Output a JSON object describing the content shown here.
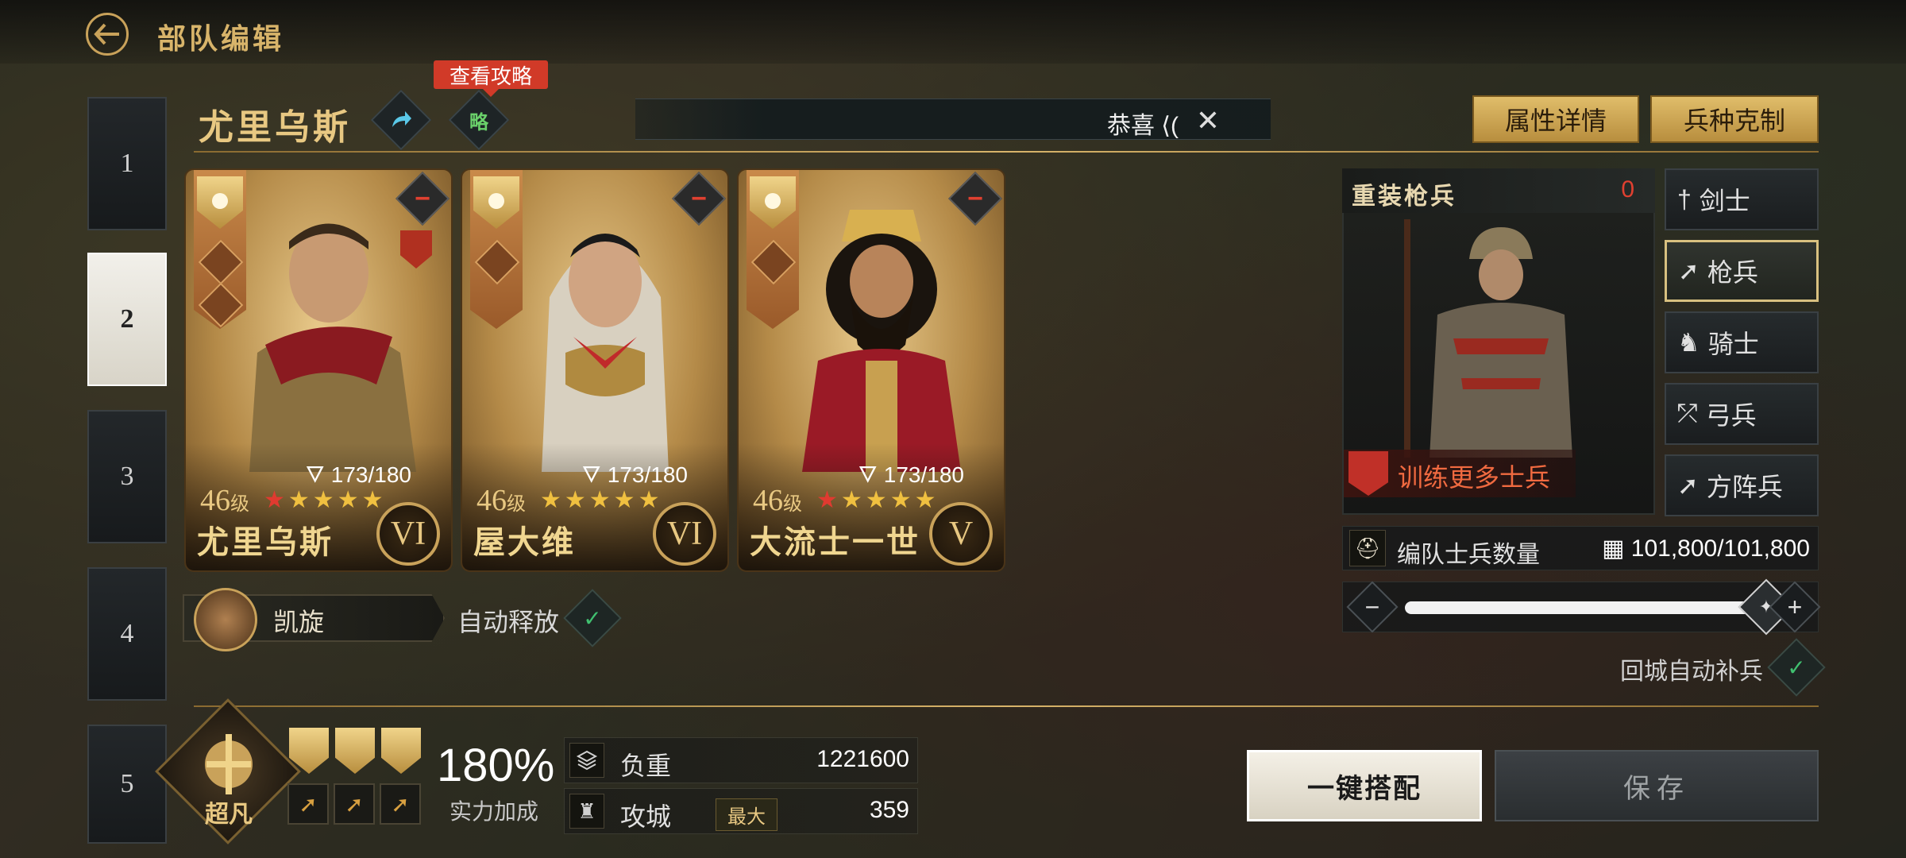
{
  "header": {
    "title": "部队编辑"
  },
  "tabs": [
    "1",
    "2",
    "3",
    "4",
    "5"
  ],
  "active_tab": "2",
  "lead_hero": {
    "name": "尤里乌斯",
    "guide_tag": "查看攻略",
    "guide_icon_text": "略"
  },
  "marquee": {
    "text": "恭喜 ⟨("
  },
  "top_buttons": {
    "attributes": "属性详情",
    "counter": "兵种克制"
  },
  "heroes": [
    {
      "name": "尤里乌斯",
      "level": "46",
      "level_unit": "级",
      "exp": "173/180",
      "rank": "VI",
      "stars": 5,
      "red_stars": 1,
      "skill_count": 2
    },
    {
      "name": "屋大维",
      "level": "46",
      "level_unit": "级",
      "exp": "173/180",
      "rank": "VI",
      "stars": 5,
      "red_stars": 0,
      "skill_count": 1
    },
    {
      "name": "大流士一世",
      "level": "46",
      "level_unit": "级",
      "exp": "173/180",
      "rank": "V",
      "stars": 5,
      "red_stars": 1,
      "skill_count": 1
    }
  ],
  "skill": {
    "name": "凯旋",
    "auto_label": "自动释放"
  },
  "troop": {
    "name": "重装枪兵",
    "count": "0",
    "train_label": "训练更多士兵",
    "types": [
      "剑士",
      "枪兵",
      "骑士",
      "弓兵",
      "方阵兵"
    ],
    "selected_type": "枪兵",
    "soldier_count_label": "编队士兵数量",
    "soldier_count": "101,800/101,800",
    "slider_value": 1.0,
    "auto_replenish_label": "回城自动补兵"
  },
  "bonus": {
    "emblem_label": "超凡",
    "percent": "180%",
    "percent_label": "实力加成"
  },
  "stats": [
    {
      "label": "负重",
      "badge": "",
      "value": "1221600"
    },
    {
      "label": "攻城",
      "badge": "最大",
      "value": "359"
    }
  ],
  "actions": {
    "auto": "一键搭配",
    "save": "保存"
  },
  "colors": {
    "gold": "#d8b46a",
    "accent_red": "#d13a28",
    "check_green": "#40c070"
  }
}
